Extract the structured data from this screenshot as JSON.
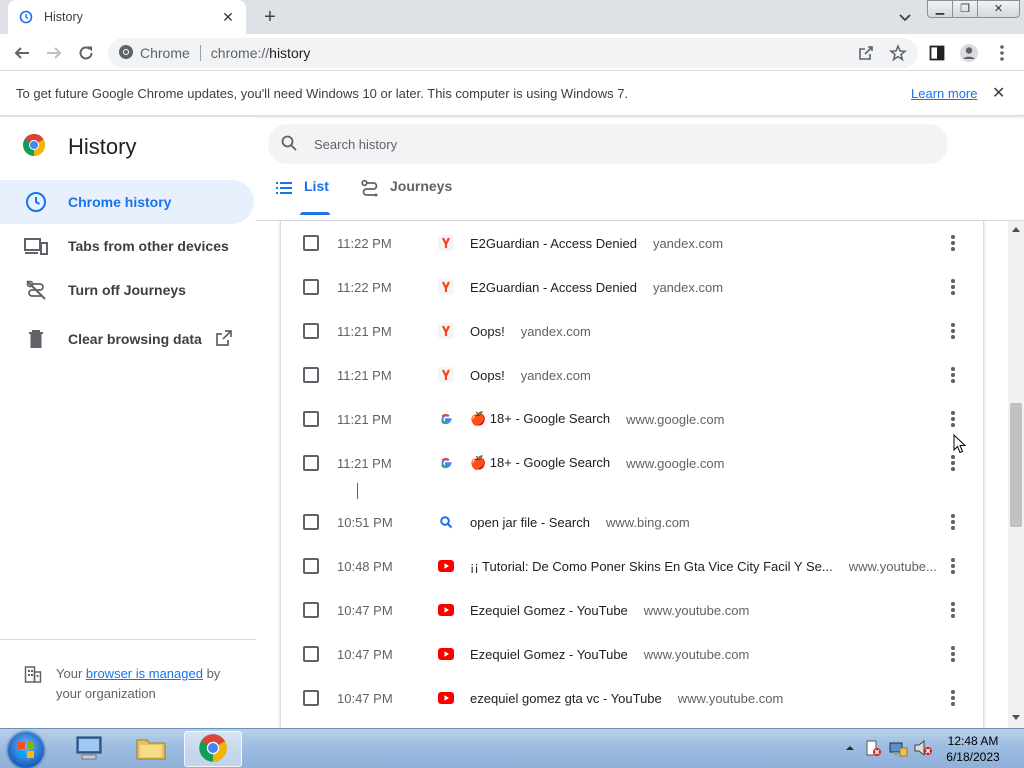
{
  "browser": {
    "tab_title": "History",
    "omnibox_site": "Chrome",
    "omnibox_url_scheme": "chrome://",
    "omnibox_url_path": "history"
  },
  "infobar": {
    "message": "To get future Google Chrome updates, you'll need Windows 10 or later. This computer is using Windows 7.",
    "link": "Learn more"
  },
  "sidebar": {
    "title": "History",
    "items": [
      {
        "label": "Chrome history",
        "icon": "clock-icon",
        "active": true
      },
      {
        "label": "Tabs from other devices",
        "icon": "devices-icon"
      },
      {
        "label": "Turn off Journeys",
        "icon": "journeys-off-icon"
      },
      {
        "label": "Clear browsing data",
        "icon": "trash-icon"
      }
    ],
    "managed_prefix": "Your ",
    "managed_link": "browser is managed",
    "managed_suffix": " by your organization"
  },
  "search": {
    "placeholder": "Search history"
  },
  "tabs": {
    "list": "List",
    "journeys": "Journeys"
  },
  "rows": [
    {
      "time": "11:22 PM",
      "favicon": "yandex",
      "title": "E2Guardian - Access Denied",
      "domain": "yandex.com"
    },
    {
      "time": "11:22 PM",
      "favicon": "yandex",
      "title": "E2Guardian - Access Denied",
      "domain": "yandex.com"
    },
    {
      "time": "11:21 PM",
      "favicon": "yandex",
      "title": "Oops!",
      "domain": "yandex.com"
    },
    {
      "time": "11:21 PM",
      "favicon": "yandex",
      "title": "Oops!",
      "domain": "yandex.com"
    },
    {
      "time": "11:21 PM",
      "favicon": "google",
      "title": "🍎 18+ - Google Search",
      "domain": "www.google.com"
    },
    {
      "time": "11:21 PM",
      "favicon": "google",
      "title": "🍎 18+ - Google Search",
      "domain": "www.google.com"
    },
    {
      "time": "10:51 PM",
      "favicon": "bing",
      "title": "open jar file - Search",
      "domain": "www.bing.com"
    },
    {
      "time": "10:48 PM",
      "favicon": "youtube",
      "title": "¡¡ Tutorial: De Como Poner Skins En Gta Vice City Facil Y Se...",
      "domain": "www.youtube..."
    },
    {
      "time": "10:47 PM",
      "favicon": "youtube",
      "title": "Ezequiel Gomez - YouTube",
      "domain": "www.youtube.com"
    },
    {
      "time": "10:47 PM",
      "favicon": "youtube",
      "title": "Ezequiel Gomez - YouTube",
      "domain": "www.youtube.com"
    },
    {
      "time": "10:47 PM",
      "favicon": "youtube",
      "title": "ezequiel gomez gta vc - YouTube",
      "domain": "www.youtube.com"
    }
  ],
  "taskbar": {
    "time": "12:48 AM",
    "date": "6/18/2023"
  },
  "colors": {
    "accent": "#1a73e8",
    "active_bg": "#e8f0fe",
    "youtube": "#ff0000",
    "yandex": "#fc3f1d"
  }
}
